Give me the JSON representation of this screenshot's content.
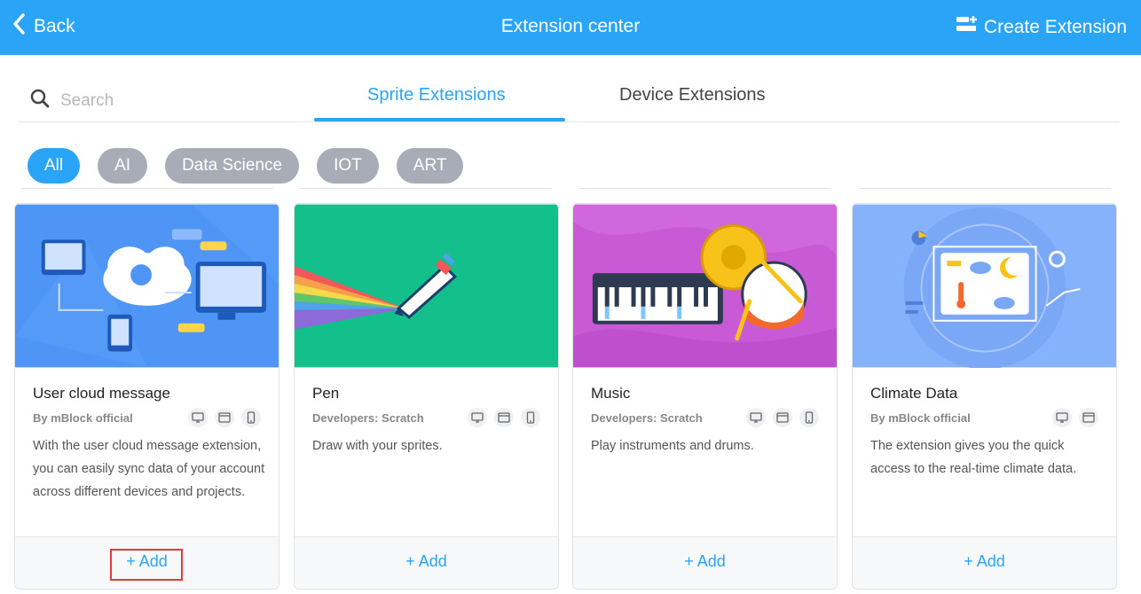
{
  "header": {
    "back_label": "Back",
    "title": "Extension center",
    "create_label": "Create Extension"
  },
  "search": {
    "placeholder": "Search"
  },
  "tabs": [
    {
      "label": "Sprite Extensions",
      "active": true
    },
    {
      "label": "Device Extensions",
      "active": false
    }
  ],
  "filters": [
    {
      "label": "All",
      "active": true
    },
    {
      "label": "AI",
      "active": false
    },
    {
      "label": "Data Science",
      "active": false
    },
    {
      "label": "IOT",
      "active": false
    },
    {
      "label": "ART",
      "active": false
    }
  ],
  "cards": [
    {
      "name": "User cloud message",
      "author": "By mBlock official",
      "platforms": [
        "desktop-icon",
        "browser-icon",
        "mobile-icon"
      ],
      "description": "With the user cloud message extension, you can easily sync data of your account across different devices and projects.",
      "add_label": "+ Add",
      "image_bg": "#4f95f5"
    },
    {
      "name": "Pen",
      "author": "Developers: Scratch",
      "platforms": [
        "desktop-icon",
        "browser-icon",
        "mobile-icon"
      ],
      "description": "Draw with your sprites.",
      "add_label": "+ Add",
      "image_bg": "#13bf8a"
    },
    {
      "name": "Music",
      "author": "Developers: Scratch",
      "platforms": [
        "desktop-icon",
        "browser-icon",
        "mobile-icon"
      ],
      "description": "Play instruments and drums.",
      "add_label": "+ Add",
      "image_bg": "#c95ad6"
    },
    {
      "name": "Climate Data",
      "author": "By mBlock official",
      "platforms": [
        "desktop-icon",
        "browser-icon"
      ],
      "description": "The extension gives you the quick access to the real-time climate data.",
      "add_label": "+ Add",
      "image_bg": "#86b1fb"
    }
  ],
  "colors": {
    "accent": "#29a4f6",
    "chip_inactive": "#a7acb6",
    "highlight": "#e03b3b"
  }
}
